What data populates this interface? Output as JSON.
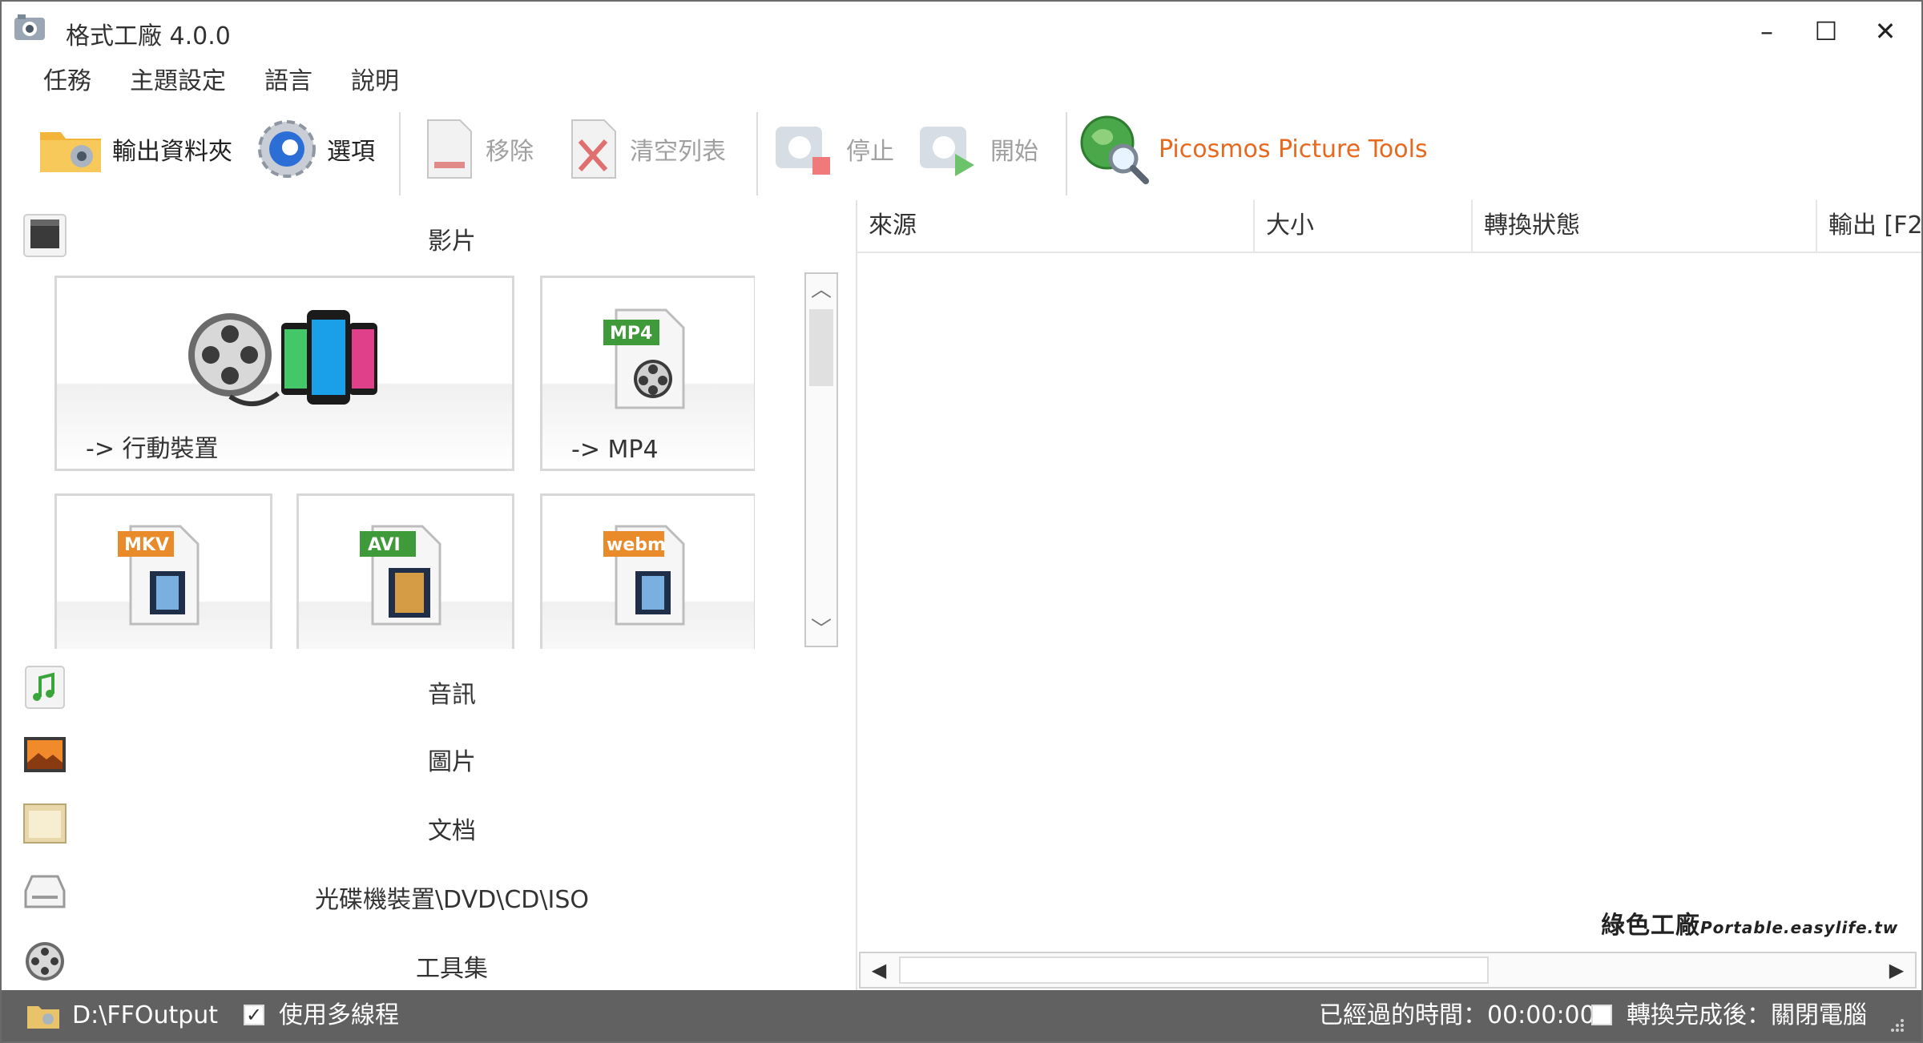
{
  "window": {
    "title": "格式工廠 4.0.0"
  },
  "controls": {
    "minimize": "–",
    "maximize": "☐",
    "close": "✕"
  },
  "menu": [
    "任務",
    "主題設定",
    "語言",
    "說明"
  ],
  "toolbar": {
    "output_folder": "輸出資料夾",
    "options": "選項",
    "remove": "移除",
    "clear_list": "清空列表",
    "stop": "停止",
    "start": "開始",
    "picosmos": "Picosmos Picture Tools"
  },
  "categories": {
    "video": "影片",
    "audio": "音訊",
    "image": "圖片",
    "document": "文档",
    "disc": "光碟機裝置\\DVD\\CD\\ISO",
    "tools": "工具集"
  },
  "tiles": [
    {
      "label": "-> 行動裝置"
    },
    {
      "label": "-> MP4",
      "badge": "MP4"
    },
    {
      "label": "",
      "badge": "MKV"
    },
    {
      "label": "",
      "badge": "AVI"
    },
    {
      "label": "",
      "badge": "webm"
    }
  ],
  "columns": [
    "來源",
    "大小",
    "轉換狀態",
    "輸出 [F2"
  ],
  "watermark": {
    "main": "綠色工廠",
    "sub": "Portable.easylife.tw"
  },
  "status": {
    "output_path": "D:\\FFOutput",
    "multithread_label": "使用多線程",
    "multithread_checked": true,
    "elapsed_label": "已經過的時間：00:00:00",
    "after_convert_label": "轉換完成後：關閉電腦",
    "after_convert_checked": false
  },
  "colors": {
    "picosmos_text": "#e8691e",
    "statusbar_bg": "#616161",
    "mkv_badge": "#e98a2b",
    "avi_badge": "#3f9a3a",
    "mp4_badge": "#3f9a3a",
    "webm_badge": "#e98a2b"
  },
  "icons": {
    "app": "format-factory-icon",
    "output_folder": "folder-icon",
    "options": "gear-icon",
    "remove": "document-remove-icon",
    "clear_list": "clear-x-icon",
    "stop": "stop-icon",
    "start": "start-icon",
    "picosmos": "globe-magnifier-icon"
  }
}
